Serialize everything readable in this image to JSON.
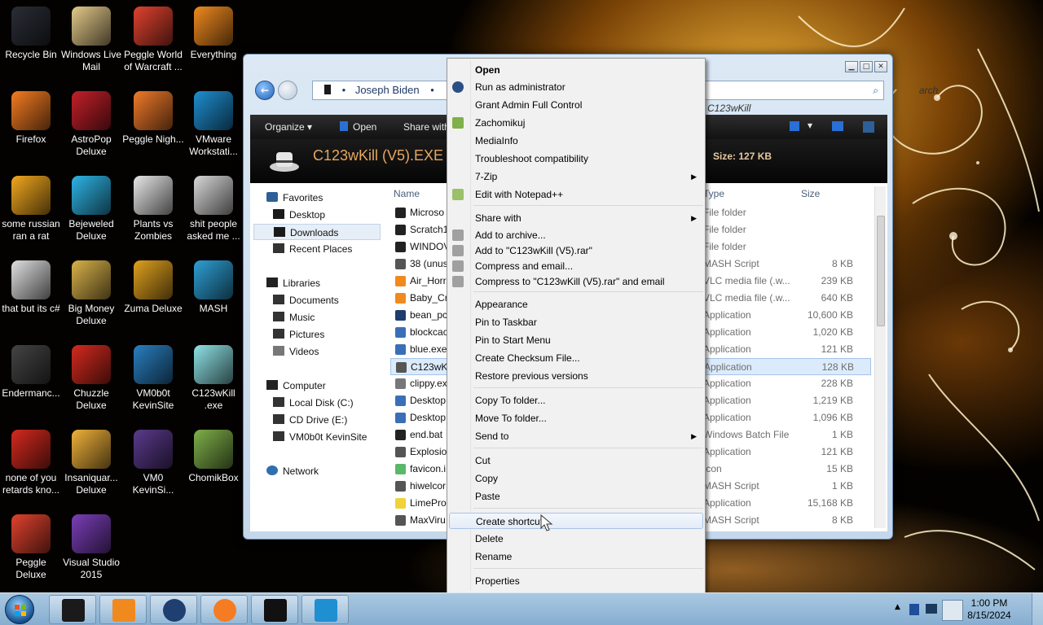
{
  "desktop": {
    "icons": [
      {
        "label": "Recycle Bin",
        "icon": "recycle-bin-icon",
        "color": "#2a2e36"
      },
      {
        "label": "Windows Live Mail",
        "icon": "mail-icon",
        "color": "#e3c98a"
      },
      {
        "label": "Peggle World of Warcraft ...",
        "icon": "peggle-icon",
        "color": "#e0422f"
      },
      {
        "label": "Everything",
        "icon": "everything-icon",
        "color": "#f08a1f"
      },
      {
        "label": "Firefox",
        "icon": "firefox-icon",
        "color": "#f57c22"
      },
      {
        "label": "AstroPop Deluxe",
        "icon": "astropop-icon",
        "color": "#c4202a"
      },
      {
        "label": "Peggle Nigh...",
        "icon": "peggle-nights-icon",
        "color": "#f07a2a"
      },
      {
        "label": "VMware Workstati...",
        "icon": "vmware-icon",
        "color": "#1f8fd2"
      },
      {
        "label": "some russian ran a rat",
        "icon": "shortcut-icon",
        "color": "#f2a81e"
      },
      {
        "label": "Bejeweled Deluxe",
        "icon": "bejeweled-icon",
        "color": "#2eb5e6"
      },
      {
        "label": "Plants vs Zombies",
        "icon": "pvz-icon",
        "color": "#e8e8e8"
      },
      {
        "label": "shit people asked me ...",
        "icon": "folder-icon",
        "color": "#d8d8d8"
      },
      {
        "label": "that but its c#",
        "icon": "shortcut-icon",
        "color": "#e0e0e0"
      },
      {
        "label": "Big Money Deluxe",
        "icon": "bigmoney-icon",
        "color": "#d9b24a"
      },
      {
        "label": "Zuma Deluxe",
        "icon": "zuma-icon",
        "color": "#e0a11f"
      },
      {
        "label": "MASH",
        "icon": "mash-icon",
        "color": "#2ea0d6"
      },
      {
        "label": "Endermanc...",
        "icon": "endermanch-icon",
        "color": "#444444"
      },
      {
        "label": "Chuzzle Deluxe",
        "icon": "chuzzle-icon",
        "color": "#d42a1f"
      },
      {
        "label": "VM0b0t KevinSite",
        "icon": "vmware-icon",
        "color": "#2a7fc0"
      },
      {
        "label": "C123wKill .exe",
        "icon": "c123wkill-icon",
        "color": "#8fe3e6"
      },
      {
        "label": "none of you retards kno...",
        "icon": "shortcut-icon",
        "color": "#d42a1f"
      },
      {
        "label": "Insaniquar... Deluxe",
        "icon": "insaniquarium-icon",
        "color": "#f0b23a"
      },
      {
        "label": "VM0 KevinSi...",
        "icon": "vmware-icon",
        "color": "#5b3a8c"
      },
      {
        "label": "ChomikBox",
        "icon": "chomikbox-icon",
        "color": "#7fb04a"
      },
      {
        "label": "Peggle Deluxe",
        "icon": "peggle-icon",
        "color": "#e0422f"
      },
      {
        "label": "Visual Studio 2015",
        "icon": "visual-studio-icon",
        "color": "#7b3fb8"
      }
    ]
  },
  "explorer": {
    "breadcrumb": "Joseph Biden",
    "search_placeholder": "arch C123wKill",
    "toolbar": {
      "organize": "Organize",
      "open": "Open",
      "share_with": "Share with"
    },
    "details": {
      "title": "C123wKill (V5).EXE",
      "size_label": "Size:",
      "size_value": "127 KB"
    },
    "nav": {
      "favorites": "Favorites",
      "desktop": "Desktop",
      "downloads": "Downloads",
      "recent": "Recent Places",
      "libraries": "Libraries",
      "documents": "Documents",
      "music": "Music",
      "pictures": "Pictures",
      "videos": "Videos",
      "computer": "Computer",
      "local_disk": "Local Disk (C:)",
      "cd_drive": "CD Drive (E:)",
      "vm_drive": "VM0b0t KevinSite",
      "network": "Network"
    },
    "columns": {
      "name": "Name",
      "type": "Type",
      "size": "Size"
    },
    "files": [
      {
        "name": "Microso",
        "type": "File folder",
        "size": "",
        "color": "#222222"
      },
      {
        "name": "Scratch1",
        "type": "File folder",
        "size": "",
        "color": "#222222"
      },
      {
        "name": "WINDOV",
        "type": "File folder",
        "size": "",
        "color": "#222222"
      },
      {
        "name": "38 (unus",
        "type": "MASH Script",
        "size": "8 KB",
        "color": "#555555"
      },
      {
        "name": "Air_Horr",
        "type": "VLC media file (.w...",
        "size": "239 KB",
        "color": "#f08a1f"
      },
      {
        "name": "Baby_Cr",
        "type": "VLC media file (.w...",
        "size": "640 KB",
        "color": "#f08a1f"
      },
      {
        "name": "bean_pc",
        "type": "Application",
        "size": "10,600 KB",
        "color": "#1c3d6e"
      },
      {
        "name": "blockcac",
        "type": "Application",
        "size": "1,020 KB",
        "color": "#3a6fb8"
      },
      {
        "name": "blue.exe",
        "type": "Application",
        "size": "121 KB",
        "color": "#3a6fb8"
      },
      {
        "name": "C123wKi",
        "type": "Application",
        "size": "128 KB",
        "color": "#555555"
      },
      {
        "name": "clippy.ex",
        "type": "Application",
        "size": "228 KB",
        "color": "#777777"
      },
      {
        "name": "Desktop",
        "type": "Application",
        "size": "1,219 KB",
        "color": "#3a6fb8"
      },
      {
        "name": "Desktop",
        "type": "Application",
        "size": "1,096 KB",
        "color": "#3a6fb8"
      },
      {
        "name": "end.bat",
        "type": "Windows Batch File",
        "size": "1 KB",
        "color": "#222222"
      },
      {
        "name": "Explosio",
        "type": "Application",
        "size": "121 KB",
        "color": "#555555"
      },
      {
        "name": "favicon.i",
        "type": "Icon",
        "size": "15 KB",
        "color": "#5ab86a"
      },
      {
        "name": "hiwelcor",
        "type": "MASH Script",
        "size": "1 KB",
        "color": "#555555"
      },
      {
        "name": "LimePro",
        "type": "Application",
        "size": "15,168 KB",
        "color": "#f0d23a"
      },
      {
        "name": "MaxViru",
        "type": "MASH Script",
        "size": "8 KB",
        "color": "#555555"
      }
    ]
  },
  "context_menu": {
    "items": [
      {
        "label": "Open",
        "bold": true,
        "icon": ""
      },
      {
        "label": "Run as administrator",
        "icon": "shield-icon"
      },
      {
        "label": "Grant Admin Full Control",
        "icon": ""
      },
      {
        "label": "Zachomikuj",
        "icon": "chomikbox-icon"
      },
      {
        "label": "MediaInfo",
        "icon": ""
      },
      {
        "label": "Troubleshoot compatibility",
        "icon": ""
      },
      {
        "label": "7-Zip",
        "icon": "",
        "submenu": true
      },
      {
        "label": "Edit with Notepad++",
        "icon": "notepad-icon"
      },
      {
        "label": "Share with",
        "icon": "",
        "submenu": true
      },
      {
        "label": "Add to archive...",
        "icon": "archive-icon"
      },
      {
        "label": "Add to \"C123wKill (V5).rar\"",
        "icon": "archive-icon"
      },
      {
        "label": "Compress and email...",
        "icon": "archive-icon"
      },
      {
        "label": "Compress to \"C123wKill (V5).rar\" and email",
        "icon": "archive-icon"
      },
      {
        "label": "Appearance",
        "icon": ""
      },
      {
        "label": "Pin to Taskbar",
        "icon": ""
      },
      {
        "label": "Pin to Start Menu",
        "icon": ""
      },
      {
        "label": "Create Checksum File...",
        "icon": ""
      },
      {
        "label": "Restore previous versions",
        "icon": ""
      },
      {
        "label": "Copy To folder...",
        "icon": ""
      },
      {
        "label": "Move To folder...",
        "icon": ""
      },
      {
        "label": "Send to",
        "icon": "",
        "submenu": true
      },
      {
        "label": "Cut",
        "icon": ""
      },
      {
        "label": "Copy",
        "icon": ""
      },
      {
        "label": "Paste",
        "icon": ""
      },
      {
        "label": "Create shortcut",
        "icon": "",
        "hover": true
      },
      {
        "label": "Delete",
        "icon": ""
      },
      {
        "label": "Rename",
        "icon": ""
      },
      {
        "label": "Properties",
        "icon": ""
      }
    ]
  },
  "taskbar": {
    "pinned": [
      {
        "icon": "explorer-icon",
        "color": "#1a1a1a"
      },
      {
        "icon": "media-player-icon",
        "color": "#f08a1f"
      },
      {
        "icon": "app-icon",
        "color": "#1f3f70"
      },
      {
        "icon": "firefox-icon",
        "color": "#f57c22"
      },
      {
        "icon": "seven-zip-icon",
        "color": "#111111"
      },
      {
        "icon": "vmware-icon",
        "color": "#1f8fd2"
      }
    ],
    "time": "1:00 PM",
    "date": "8/15/2024"
  }
}
